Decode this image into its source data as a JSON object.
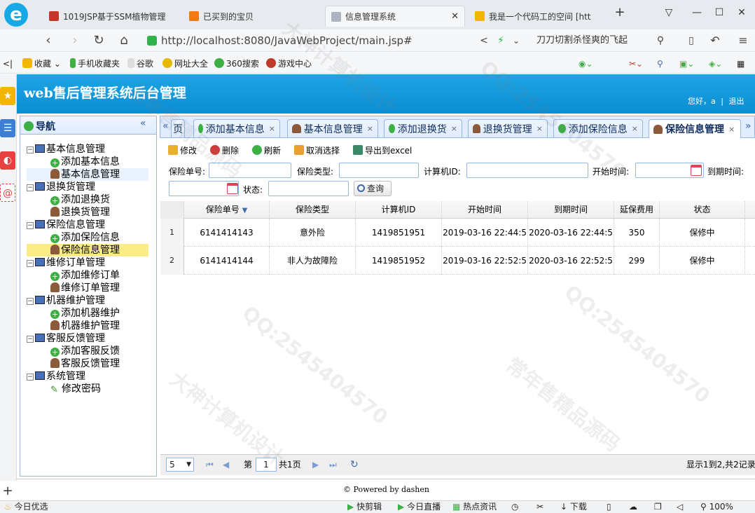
{
  "browser": {
    "tabs": [
      {
        "title": "1019JSP基于SSM植物管理",
        "favicon_color": "#c0392b"
      },
      {
        "title": "已买到的宝贝",
        "favicon_color": "#f07a16"
      },
      {
        "title": "信息管理系统",
        "favicon_color": "#aab4c0"
      },
      {
        "title": "我是一个代码工的空间 [htt",
        "favicon_color": "#f2b600"
      }
    ],
    "new_tab_label": "+",
    "url": "http://localhost:8080/JavaWebProject/main.jsp#",
    "search_text": "刀刀切割杀怪爽的飞起",
    "bookmarks": [
      "收藏",
      "手机收藏夹",
      "谷歌",
      "网址大全",
      "360搜索",
      "游戏中心"
    ]
  },
  "app": {
    "title": "web售后管理系统后台管理",
    "greeting": "您好，a",
    "separator": "|",
    "logout": "退出",
    "footer": "© Powered by dashen"
  },
  "nav": {
    "title": "导航",
    "collapse": "«",
    "groups": [
      {
        "label": "基本信息管理",
        "items": [
          "添加基本信息",
          "基本信息管理"
        ]
      },
      {
        "label": "退换货管理",
        "items": [
          "添加退换货",
          "退换货管理"
        ]
      },
      {
        "label": "保险信息管理",
        "items": [
          "添加保险信息",
          "保险信息管理"
        ]
      },
      {
        "label": "维修订单管理",
        "items": [
          "添加维修订单",
          "维修订单管理"
        ]
      },
      {
        "label": "机器维护管理",
        "items": [
          "添加机器维护",
          "机器维护管理"
        ]
      },
      {
        "label": "客服反馈管理",
        "items": [
          "添加客服反馈",
          "客服反馈管理"
        ]
      },
      {
        "label": "系统管理",
        "items": [
          "修改密码"
        ]
      }
    ]
  },
  "content_tabs": {
    "scroll_left": "«",
    "scroll_right": "»",
    "partial": "页",
    "items": [
      "添加基本信息",
      "基本信息管理",
      "添加退换货",
      "退换货管理",
      "添加保险信息",
      "保险信息管理"
    ],
    "close": "×"
  },
  "toolbar": {
    "edit": "修改",
    "delete": "删除",
    "refresh": "刷新",
    "deselect": "取消选择",
    "export": "导出到excel"
  },
  "search": {
    "policy_no": "保险单号:",
    "ins_type": "保险类型:",
    "computer_id": "计算机ID:",
    "start_time": "开始时间:",
    "end_time": "到期时间:",
    "status": "状态:",
    "query": "查询"
  },
  "grid": {
    "columns": [
      "保险单号",
      "保险类型",
      "计算机ID",
      "开始时间",
      "到期时间",
      "延保费用",
      "状态"
    ],
    "sort_indicator": "▼",
    "rows": [
      {
        "num": "1",
        "cells": [
          "6141414143",
          "意外险",
          "1419851951",
          "2019-03-16 22:44:5",
          "2020-03-16 22:44:5",
          "350",
          "保修中"
        ]
      },
      {
        "num": "2",
        "cells": [
          "6141414144",
          "非人为故障险",
          "1419851952",
          "2019-03-16 22:52:5",
          "2020-03-16 22:52:5",
          "299",
          "保修中"
        ]
      }
    ]
  },
  "pager": {
    "page_size": "5",
    "page_prefix": "第",
    "page_value": "1",
    "page_suffix": "共1页",
    "summary": "显示1到2,共2记录"
  },
  "statusbar": {
    "left": "今日优选",
    "items": [
      "快剪辑",
      "今日直播",
      "热点资讯",
      "下载",
      "100%"
    ]
  },
  "watermarks": [
    "QQ:2545404570",
    "大神计算机设计",
    "常年售精品源码"
  ]
}
